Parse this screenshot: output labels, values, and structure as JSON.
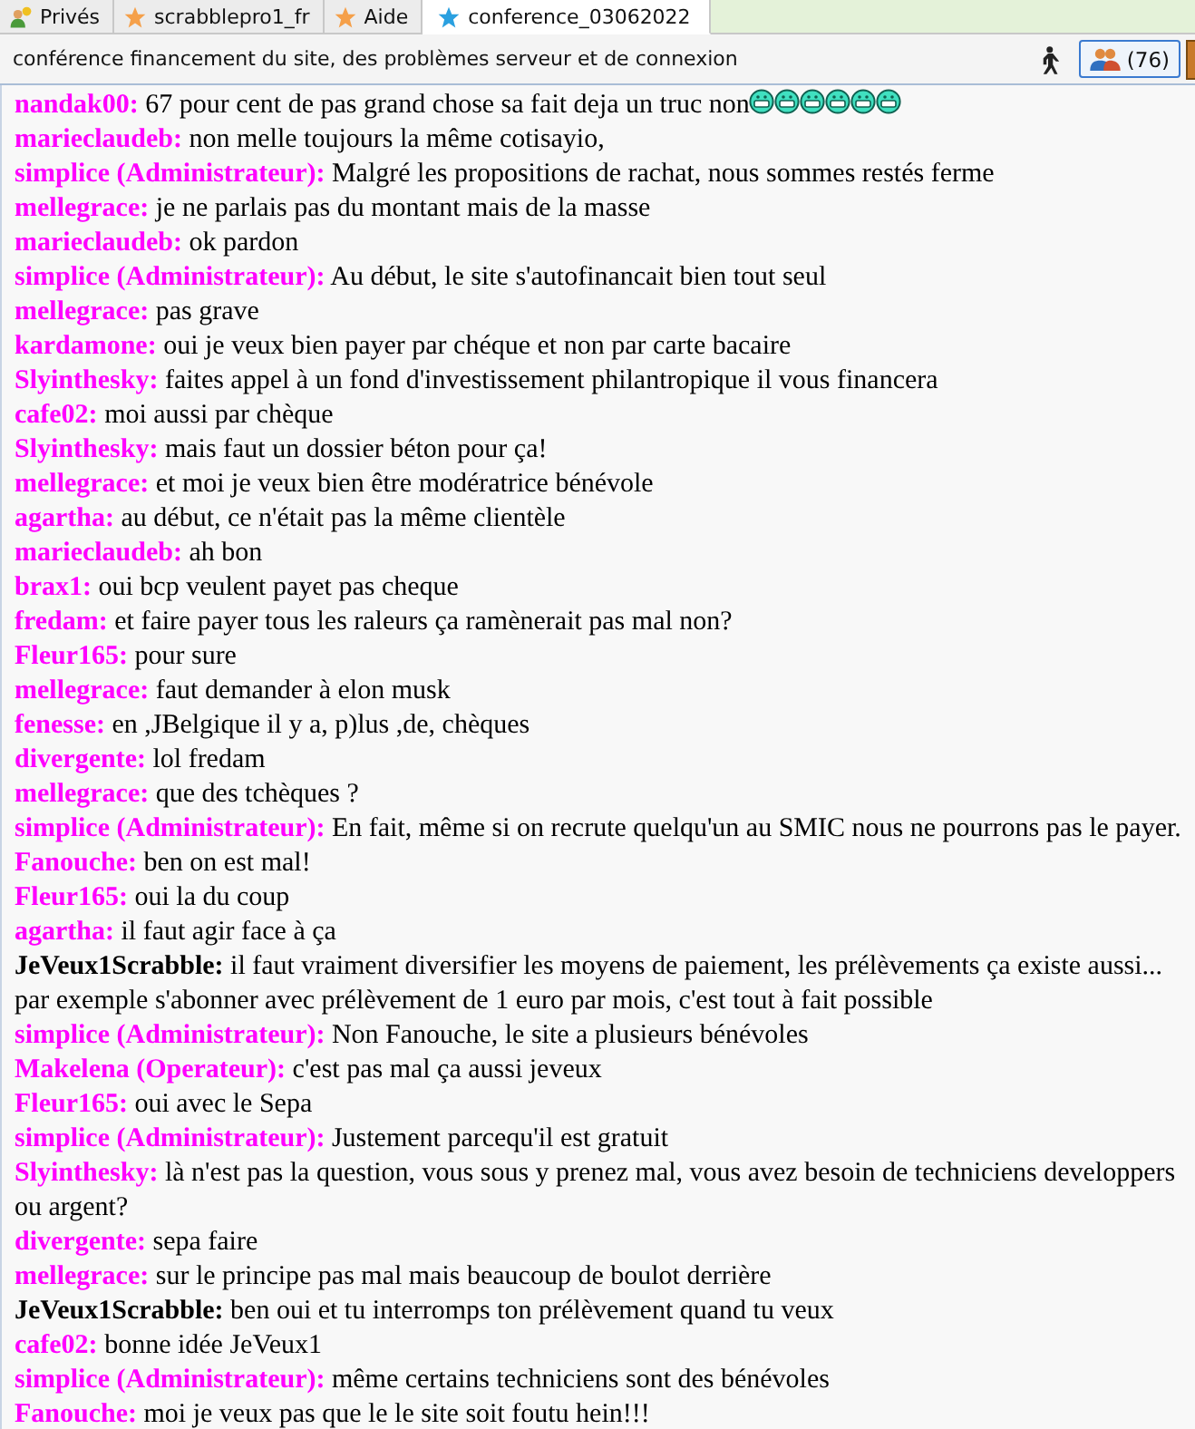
{
  "tabs": [
    {
      "label": "Privés",
      "kind": "private",
      "selected": false
    },
    {
      "label": "scrabblepro1_fr",
      "kind": "room",
      "color": "#f5a04a",
      "selected": false
    },
    {
      "label": "Aide",
      "kind": "room",
      "color": "#f5a04a",
      "selected": false
    },
    {
      "label": "conference_03062022",
      "kind": "room",
      "color": "#2aa0e0",
      "selected": true
    }
  ],
  "topic": "conférence financement du site, des problèmes serveur et de connexion",
  "users_button": {
    "label": "(76)"
  },
  "messages": [
    {
      "author": "nandak00:",
      "text": "67 pour cent de pas grand chose sa fait deja un truc non",
      "smileys": [
        {
          "kind": "grin"
        },
        {
          "kind": "grin"
        },
        {
          "kind": "grin"
        },
        {
          "kind": "grin"
        },
        {
          "kind": "grin"
        },
        {
          "kind": "grin"
        }
      ],
      "color": "#ff00ff"
    },
    {
      "author": "marieclaudeb:",
      "text": "non melle toujours la même cotisayio,",
      "color": "#ff00ff"
    },
    {
      "author": "simplice (Administrateur):",
      "text": "Malgré les propositions de rachat, nous sommes restés ferme",
      "color": "#ff00ff"
    },
    {
      "author": "mellegrace:",
      "text": "je ne parlais pas du montant mais de la masse",
      "color": "#ff00ff"
    },
    {
      "author": "marieclaudeb:",
      "text": "ok pardon",
      "color": "#ff00ff"
    },
    {
      "author": "simplice (Administrateur):",
      "text": "Au début, le site s'autofinancait bien tout seul",
      "color": "#ff00ff"
    },
    {
      "author": "mellegrace:",
      "text": "pas grave",
      "color": "#ff00ff"
    },
    {
      "author": "kardamone:",
      "text": "oui je veux bien payer par chéque et non par carte bacaire",
      "color": "#ff00ff"
    },
    {
      "author": "Slyinthesky:",
      "text": "faites appel à un fond d'investissement philantropique il vous financera",
      "color": "#ff00ff"
    },
    {
      "author": "cafe02:",
      "text": "moi aussi par chèque",
      "color": "#ff00ff"
    },
    {
      "author": "Slyinthesky:",
      "text": "mais faut un dossier béton pour ça!",
      "color": "#ff00ff"
    },
    {
      "author": "mellegrace:",
      "text": "et moi je veux bien être modératrice bénévole",
      "color": "#ff00ff"
    },
    {
      "author": "agartha:",
      "text": "au début, ce n'était pas la même clientèle",
      "color": "#ff00ff"
    },
    {
      "author": "marieclaudeb:",
      "text": "ah bon",
      "color": "#ff00ff"
    },
    {
      "author": "brax1:",
      "text": "oui bcp veulent payet pas cheque",
      "color": "#ff00ff"
    },
    {
      "author": "fredam:",
      "text": "et faire payer tous les raleurs ça ramènerait pas mal non?",
      "color": "#ff00ff"
    },
    {
      "author": "Fleur165:",
      "text": "pour sure",
      "color": "#ff00ff"
    },
    {
      "author": "mellegrace:",
      "text": "faut demander à elon musk",
      "color": "#ff00ff"
    },
    {
      "author": "fenesse:",
      "text": "en ,JBelgique il y a, p)lus ,de, chèques",
      "color": "#ff00ff"
    },
    {
      "author": "divergente:",
      "text": "lol fredam",
      "color": "#ff00ff"
    },
    {
      "author": "mellegrace:",
      "text": "que des tchèques ?",
      "color": "#ff00ff"
    },
    {
      "author": "simplice (Administrateur):",
      "text": "En fait, même si on recrute quelqu'un au SMIC nous ne pourrons pas le payer.",
      "color": "#ff00ff"
    },
    {
      "author": "Fanouche:",
      "text": "ben on est mal!",
      "color": "#ff00ff"
    },
    {
      "author": "Fleur165:",
      "text": "oui la du coup",
      "color": "#ff00ff"
    },
    {
      "author": "agartha:",
      "text": "il faut agir face à ça",
      "color": "#ff00ff"
    },
    {
      "author": "JeVeux1Scrabble:",
      "text": "il faut vraiment diversifier les moyens de paiement, les prélèvements ça existe aussi... par exemple s'abonner avec prélèvement de 1 euro par mois, c'est tout à fait possible",
      "color": "#000000"
    },
    {
      "author": "simplice (Administrateur):",
      "text": "Non Fanouche, le site a plusieurs bénévoles",
      "color": "#ff00ff"
    },
    {
      "author": "Makelena (Operateur):",
      "text": "c'est pas mal ça aussi jeveux",
      "color": "#ff00ff"
    },
    {
      "author": "Fleur165:",
      "text": "oui avec le Sepa",
      "color": "#ff00ff"
    },
    {
      "author": "simplice (Administrateur):",
      "text": "Justement parcequ'il est gratuit",
      "color": "#ff00ff"
    },
    {
      "author": "Slyinthesky:",
      "text": "là n'est pas la question, vous sous y prenez mal, vous avez besoin de techniciens developpers ou argent?",
      "color": "#ff00ff"
    },
    {
      "author": "divergente:",
      "text": "sepa faire",
      "color": "#ff00ff"
    },
    {
      "author": "mellegrace:",
      "text": "sur le principe pas mal mais beaucoup de boulot derrière",
      "color": "#ff00ff"
    },
    {
      "author": "JeVeux1Scrabble:",
      "text": "ben oui et tu interromps ton prélèvement quand tu veux",
      "color": "#000000"
    },
    {
      "author": "cafe02:",
      "text": "bonne idée JeVeux1",
      "color": "#ff00ff"
    },
    {
      "author": "simplice (Administrateur):",
      "text": "même certains techniciens sont des bénévoles",
      "color": "#ff00ff"
    },
    {
      "author": "Fanouche:",
      "text": "moi je veux pas que le le site soit foutu hein!!!",
      "color": "#ff00ff"
    }
  ]
}
